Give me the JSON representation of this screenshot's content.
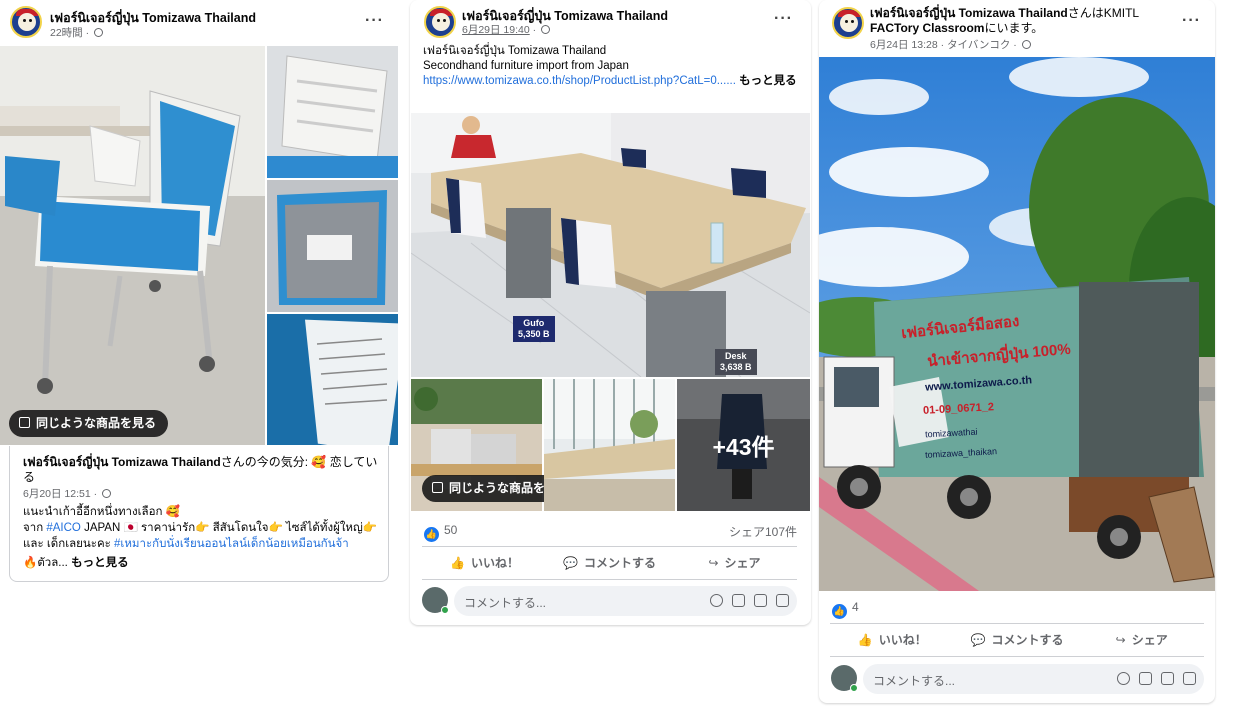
{
  "post1": {
    "author": "เฟอร์นิเจอร์ญี่ปุ่น Tomizawa Thailand",
    "time": "22時間",
    "similar_button": "同じような商品を見る",
    "shared": {
      "author": "เฟอร์นิเจอร์ญี่ปุ่น Tomizawa Thailand",
      "feeling": "さんの今の気分: 🥰 恋している",
      "time": "6月20日 12:51",
      "line1": "แนะนำเก้าอี้อีกหนึ่งทางเลือก 🥰",
      "line2_pre": "จาก ",
      "line2_link": "#AICO",
      "line2_post": " JAPAN 🇯🇵 ราคาน่ารัก👉 สีสันโดนใจ👉 ไซส์ได้ทั้งผู้ใหญ่👉",
      "line3_pre": "และ เด็กเลยนะคะ ",
      "line3_link": "#เหมาะกับนั่งเรียนออนไลน์เด็กน้อยเหมือนกันจ้า",
      "line4": "🔥ตัวล...",
      "see_more": "もっと見る"
    }
  },
  "post2": {
    "author": "เฟอร์นิเจอร์ญี่ปุ่น Tomizawa Thailand",
    "time": "6月29日 19:40",
    "text_line1": "เฟอร์นิเจอร์ญี่ปุ่น Tomizawa Thailand",
    "text_line2": "Secondhand furniture import from Japan",
    "link": "https://www.tomizawa.co.th/shop/ProductList.php?CatL=0......",
    "see_more": "もっと見る",
    "price_tags": [
      {
        "name": "Gufo",
        "price": "5,350 B"
      },
      {
        "name": "Desk",
        "price": "3,638 B"
      }
    ],
    "more_count": "+43件",
    "similar_button": "同じような商品を見る",
    "likes": "50",
    "shares": "シェア107件",
    "actions": {
      "like": "いいね！",
      "comment": "コメントする",
      "share": "シェア"
    },
    "comment_placeholder": "コメントする..."
  },
  "post3": {
    "author": "เฟอร์นิเจอร์ญี่ปุ่น Tomizawa Thailand",
    "location_suffix": "さんはKMITL",
    "location_line2": "FACTory Classroom",
    "location_suffix2": "にいます。",
    "time": "6月24日 13:28",
    "place": "タイバンコク",
    "truck_text": {
      "line1": "เฟอร์นิเจอร์มือสอง",
      "line2": "นำเข้าจากญี่ปุ่น 100%",
      "site": "www.tomizawa.co.th",
      "phone": "01-09_0671_2",
      "fb": "tomizawathai",
      "line": "tomizawa_thaikan"
    },
    "likes": "4",
    "actions": {
      "like": "いいね！",
      "comment": "コメントする",
      "share": "シェア"
    },
    "comment_placeholder": "コメントする..."
  }
}
